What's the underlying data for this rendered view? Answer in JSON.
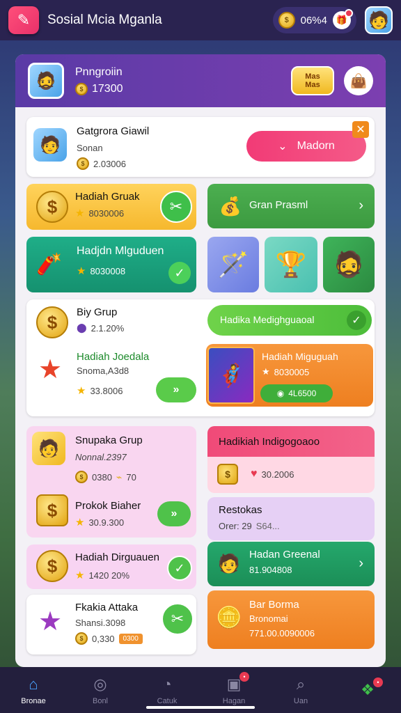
{
  "app": {
    "title": "Sosial Mcia Mganla",
    "coin_count": "06%4"
  },
  "profile": {
    "name": "Pnngroiin",
    "coins": "17300"
  },
  "header_badge": {
    "line1": "Mas",
    "line2": "Mas"
  },
  "featured": {
    "title": "Gatgrora Giawil",
    "subtitle": "Sonan",
    "amount": "2.03006",
    "button": "Madorn"
  },
  "card_yellow": {
    "title": "Hadiah Gruak",
    "amount": "8030006"
  },
  "card_green_promo": {
    "title": "Gran Prasml"
  },
  "card_teal": {
    "title": "Hadjdn Mlguduen",
    "amount": "8030008"
  },
  "group_card": {
    "title": "Biy Grup",
    "amount": "2.1.20%",
    "sub_title": "Hadiah Joedala",
    "sub_subtitle": "Snoma,A3d8",
    "sub_amount": "33.8006"
  },
  "green_pill": {
    "label": "Hadika Medighguaoal"
  },
  "game_card": {
    "title": "Hadiah Miguguah",
    "amount": "8030005",
    "button": "4L6500"
  },
  "pink_group": {
    "title": "Snupaka Grup",
    "subtitle": "Nonnal.2397",
    "amount1": "0380",
    "amount2": "70",
    "item2_title": "Prokok Biaher",
    "item2_amount": "30.9.300"
  },
  "pink_header": {
    "label": "Hadikiah Indigogoaoo",
    "amount": "30.2006"
  },
  "lavender": {
    "title": "Restokas",
    "line": "Orer: 29",
    "extra": "S64..."
  },
  "green_card2": {
    "title": "Hadan Greenal",
    "amount": "81.904808"
  },
  "card_dirg": {
    "title": "Hadiah Dirguauen",
    "amount": "1420 20%"
  },
  "card_attaka": {
    "title": "Fkakia Attaka",
    "subtitle": "Shansi.3098",
    "amount": "0,330",
    "tag": "0300"
  },
  "orange_card": {
    "title": "Bar Borma",
    "subtitle": "Bronomai",
    "amount": "771.00.0090006"
  },
  "nav": [
    {
      "label": "Bronae"
    },
    {
      "label": "Bonl"
    },
    {
      "label": "Catuk"
    },
    {
      "label": "Hagan"
    },
    {
      "label": "Uan"
    }
  ],
  "colors": {
    "purple": "#6a3db0",
    "pink": "#f0426e",
    "green": "#4caf50",
    "orange": "#f0922e",
    "teal": "#1fa382",
    "yellow": "#ffc947"
  }
}
